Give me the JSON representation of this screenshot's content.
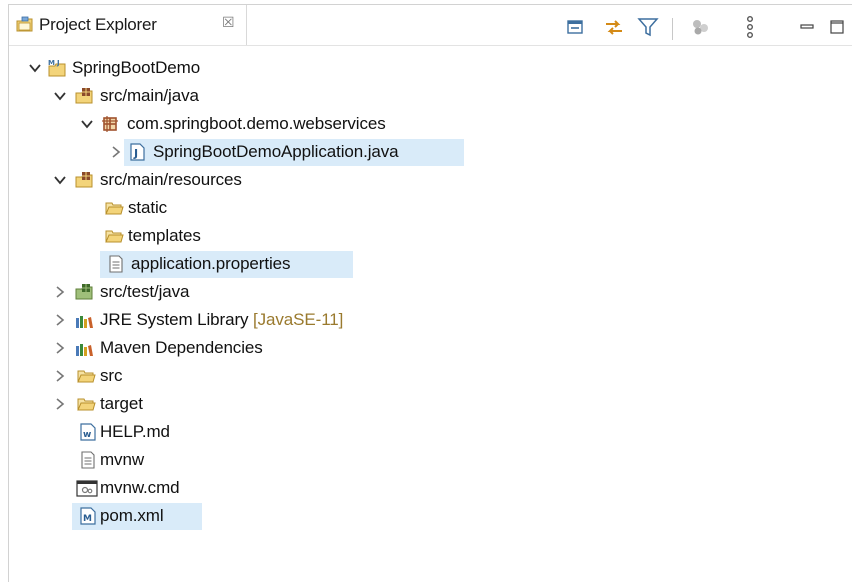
{
  "view": {
    "title": "Project Explorer",
    "close_glyph": "☒"
  },
  "toolbar": [
    {
      "name": "collapse-all-icon"
    },
    {
      "name": "link-with-editor-icon"
    },
    {
      "name": "filter-icon"
    },
    {
      "name": "working-sets-icon"
    },
    {
      "name": "view-menu-icon"
    },
    {
      "name": "minimize-icon"
    },
    {
      "name": "maximize-icon"
    }
  ],
  "tree": {
    "project": "SpringBootDemo",
    "main_java": "src/main/java",
    "package": "com.springboot.demo.webservices",
    "app_class": "SpringBootDemoApplication.java",
    "main_resources": "src/main/resources",
    "static": "static",
    "templates": "templates",
    "app_props": "application.properties",
    "test_java": "src/test/java",
    "jre_label": "JRE System Library",
    "jre_decoration": "[JavaSE-11]",
    "maven_deps": "Maven Dependencies",
    "src": "src",
    "target": "target",
    "help": "HELP.md",
    "mvnw": "mvnw",
    "mvnw_cmd": "mvnw.cmd",
    "pom": "pom.xml"
  },
  "colors": {
    "selection": "#d9ebf9",
    "folder": "#e7c46a",
    "package": "#a0522d",
    "decoration": "#9a7a2e"
  }
}
